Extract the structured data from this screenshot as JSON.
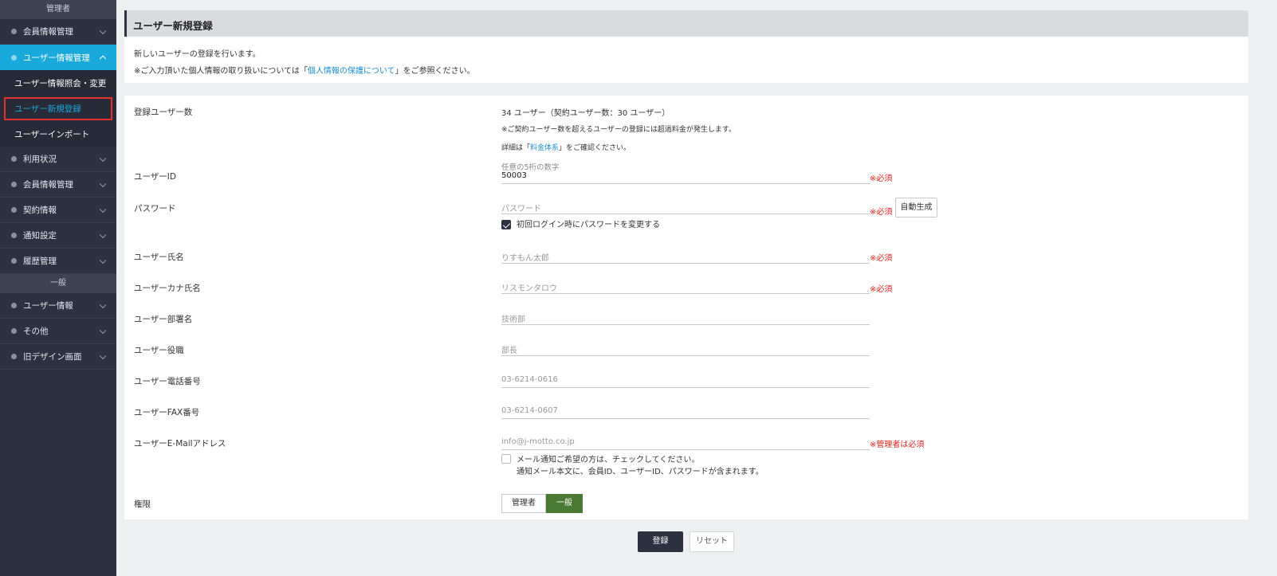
{
  "sidebar": {
    "section_admin": "管理者",
    "section_general": "一般",
    "items_admin": [
      {
        "label": "会員情報管理"
      },
      {
        "label": "ユーザー情報管理"
      }
    ],
    "sub_items": [
      {
        "label": "ユーザー情報照会・変更"
      },
      {
        "label": "ユーザー新規登録"
      },
      {
        "label": "ユーザーインポート"
      }
    ],
    "items_admin_rest": [
      {
        "label": "利用状況"
      },
      {
        "label": "会員情報管理"
      },
      {
        "label": "契約情報"
      },
      {
        "label": "通知設定"
      },
      {
        "label": "履歴管理"
      }
    ],
    "items_general": [
      {
        "label": "ユーザー情報"
      },
      {
        "label": "その他"
      },
      {
        "label": "旧デザイン画面"
      }
    ]
  },
  "page": {
    "title": "ユーザー新規登録",
    "intro_line1": "新しいユーザーの登録を行います。",
    "intro_line2_pre": "※ご入力頂いた個人情報の取り扱いについては「",
    "intro_link": "個人情報の保護について",
    "intro_line2_post": "」をご参照ください。"
  },
  "form": {
    "user_count": {
      "label": "登録ユーザー数",
      "value": "34 ユーザー（契約ユーザー数：30 ユーザー）",
      "note1": "※ご契約ユーザー数を超えるユーザーの登録には超過料金が発生します。",
      "note2_pre": "詳細は「",
      "note2_link": "料金体系",
      "note2_post": "」をご確認ください。"
    },
    "user_id": {
      "label": "ユーザーID",
      "hint": "任意の5桁の数字",
      "value": "50003",
      "required": "※必須"
    },
    "password": {
      "label": "パスワード",
      "placeholder": "パスワード",
      "required": "※必須",
      "auto_button": "自動生成",
      "change_check_label": "初回ログイン時にパスワードを変更する"
    },
    "name": {
      "label": "ユーザー氏名",
      "placeholder": "りすもん太郎",
      "required": "※必須"
    },
    "kana": {
      "label": "ユーザーカナ氏名",
      "placeholder": "リスモンタロウ",
      "required": "※必須"
    },
    "dept": {
      "label": "ユーザー部署名",
      "placeholder": "技術部"
    },
    "position": {
      "label": "ユーザー役職",
      "placeholder": "部長"
    },
    "phone": {
      "label": "ユーザー電話番号",
      "placeholder": "03-6214-0616"
    },
    "fax": {
      "label": "ユーザーFAX番号",
      "placeholder": "03-6214-0607"
    },
    "email": {
      "label": "ユーザーE-Mailアドレス",
      "placeholder": "info@j-motto.co.jp",
      "required": "※管理者は必須",
      "notify_line1": "メール通知ご希望の方は、チェックしてください。",
      "notify_line2": "通知メール本文に、会員ID、ユーザーID、パスワードが含まれます。"
    },
    "role": {
      "label": "権限",
      "options": [
        "管理者",
        "一般"
      ],
      "selected": "一般"
    }
  },
  "actions": {
    "submit": "登録",
    "reset": "リセット"
  }
}
